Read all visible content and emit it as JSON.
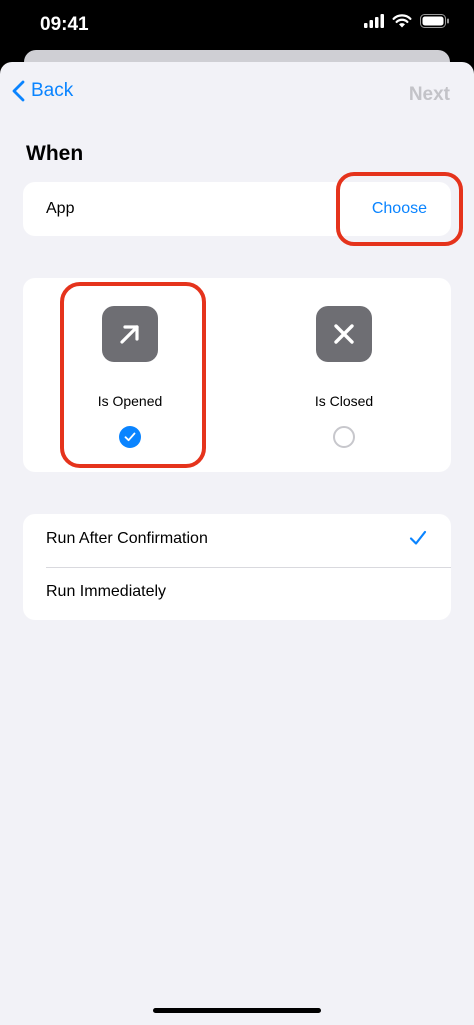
{
  "status_bar": {
    "time": "09:41"
  },
  "nav": {
    "back_label": "Back",
    "next_label": "Next"
  },
  "section": {
    "title": "When"
  },
  "app_row": {
    "label": "App",
    "choose_label": "Choose"
  },
  "events": [
    {
      "label": "Is Opened",
      "icon": "arrow-up-right-icon",
      "selected": true
    },
    {
      "label": "Is Closed",
      "icon": "x-mark-icon",
      "selected": false
    }
  ],
  "run_options": [
    {
      "label": "Run After Confirmation",
      "selected": true
    },
    {
      "label": "Run Immediately",
      "selected": false
    }
  ],
  "colors": {
    "accent": "#0a84ff",
    "highlight": "#e5331c",
    "background": "#f2f2f7",
    "icon_bg": "#6e6e73"
  }
}
